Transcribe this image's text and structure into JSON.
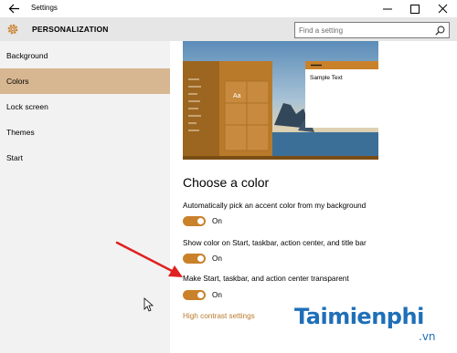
{
  "window": {
    "title": "Settings",
    "controls": {
      "minimize": "minimize-icon",
      "maximize": "maximize-icon",
      "close": "close-icon"
    }
  },
  "header": {
    "title": "PERSONALIZATION",
    "icon": "gear-icon"
  },
  "search": {
    "placeholder": "Find a setting",
    "icon": "search-icon"
  },
  "sidebar": {
    "items": [
      {
        "label": "Background",
        "active": false
      },
      {
        "label": "Colors",
        "active": true
      },
      {
        "label": "Lock screen",
        "active": false
      },
      {
        "label": "Themes",
        "active": false
      },
      {
        "label": "Start",
        "active": false
      }
    ]
  },
  "preview": {
    "tile_label": "Aa",
    "sample_text": "Sample Text"
  },
  "main": {
    "section_title": "Choose a color",
    "options": [
      {
        "label": "Automatically pick an accent color from my background",
        "state": "On"
      },
      {
        "label": "Show color on Start, taskbar, action center, and title bar",
        "state": "On"
      },
      {
        "label": "Make Start, taskbar, and action center transparent",
        "state": "On"
      }
    ],
    "high_contrast_link": "High contrast settings"
  },
  "watermark": {
    "brand": "Taimienphi",
    "suffix": ".vn"
  },
  "colors": {
    "accent": "#c9812a",
    "sidebar_active": "#d7b791",
    "sidebar_bg": "#f2f2f2",
    "header_bg": "#e6e6e6",
    "link": "#b97a2a",
    "annotation_arrow": "#e02020"
  }
}
